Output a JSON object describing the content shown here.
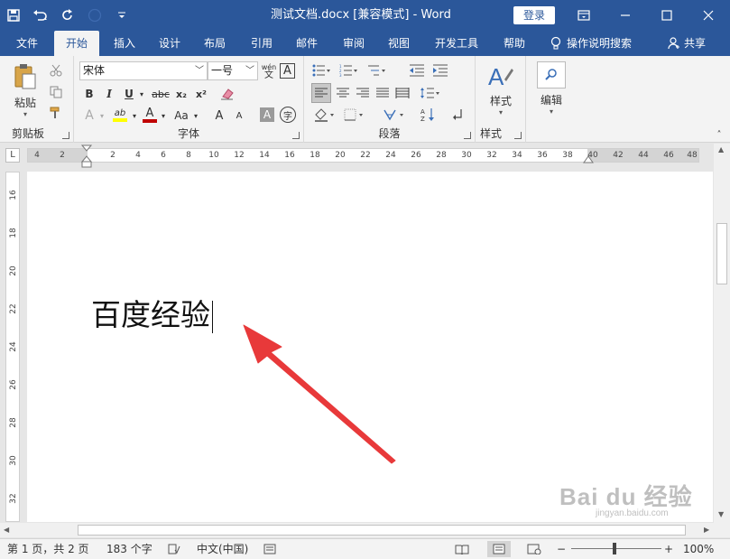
{
  "window": {
    "title": "测试文档.docx [兼容模式]  -  Word",
    "login_label": "登录",
    "accent_color": "#2b579a"
  },
  "qat": {
    "icons": [
      "save-icon",
      "undo-icon",
      "redo-icon",
      "touch-mode-icon",
      "customize-icon"
    ]
  },
  "tabs": [
    "文件",
    "开始",
    "插入",
    "设计",
    "布局",
    "引用",
    "邮件",
    "审阅",
    "视图",
    "开发工具",
    "帮助"
  ],
  "active_tab": "开始",
  "tell_me": "操作说明搜索",
  "share": "共享",
  "ribbon": {
    "clipboard": {
      "label": "剪贴板",
      "paste": "粘贴"
    },
    "font": {
      "label": "字体",
      "font_name": "宋体",
      "font_size": "一号",
      "wen": "wén",
      "wen_char": "文",
      "border_char": "A",
      "bold": "B",
      "italic": "I",
      "underline": "U",
      "strike": "abc",
      "sub": "x₂",
      "sup": "x²",
      "effect": "A",
      "highlight": "ab",
      "color": "A",
      "case": "Aa",
      "grow": "A",
      "shrink": "A",
      "shade": "A",
      "circle": "字"
    },
    "paragraph": {
      "label": "段落"
    },
    "styles": {
      "label": "样式",
      "button": "样式"
    },
    "editing": {
      "button": "编辑"
    }
  },
  "ruler": {
    "h_ticks": [
      "4",
      "2",
      "2",
      "4",
      "6",
      "8",
      "10",
      "12",
      "14",
      "16",
      "18",
      "20",
      "22",
      "24",
      "26",
      "28",
      "30",
      "32",
      "34",
      "36",
      "38",
      "40",
      "42",
      "44",
      "46",
      "48"
    ],
    "v_ticks": [
      "16",
      "18",
      "20",
      "22",
      "24",
      "26",
      "28",
      "30",
      "32"
    ],
    "corner": "L"
  },
  "document": {
    "text": "百度经验"
  },
  "status": {
    "page": "第 1 页，共 2 页",
    "words": "183 个字",
    "language": "中文(中国)",
    "zoom": "100%",
    "zoom_minus": "−",
    "zoom_plus": "+"
  },
  "watermark": {
    "main": "Bai du 经验",
    "sub": "jingyan.baidu.com"
  }
}
